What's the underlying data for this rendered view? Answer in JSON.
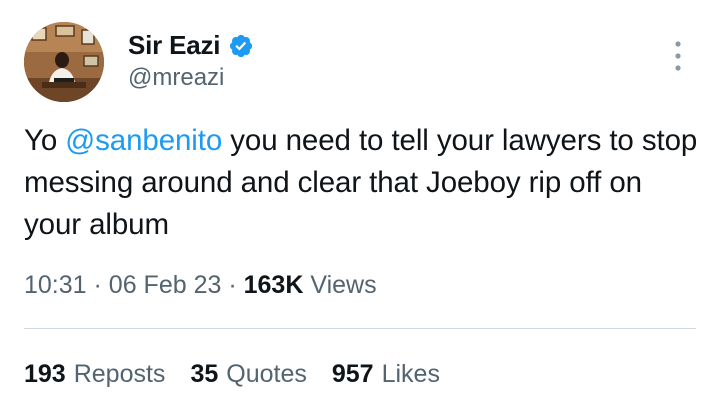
{
  "author": {
    "display_name": "Sir Eazi",
    "handle": "@mreazi",
    "verified_icon": "verified-badge-icon",
    "verified_color": "#1d9bf0"
  },
  "tweet": {
    "text_before": "Yo ",
    "mention": "@sanbenito",
    "text_after": " you need to tell your lawyers to stop messing around and clear that Joeboy rip off on your album"
  },
  "meta": {
    "time": "10:31",
    "separator": "·",
    "date": "06 Feb 23",
    "views_count": "163K",
    "views_label": "Views"
  },
  "stats": {
    "reposts_count": "193",
    "reposts_label": "Reposts",
    "quotes_count": "35",
    "quotes_label": "Quotes",
    "likes_count": "957",
    "likes_label": "Likes"
  },
  "icons": {
    "more": "more-options-icon"
  },
  "colors": {
    "text": "#0f1419",
    "secondary": "#536471",
    "link": "#1d9bf0",
    "divider": "#cfd9de"
  }
}
